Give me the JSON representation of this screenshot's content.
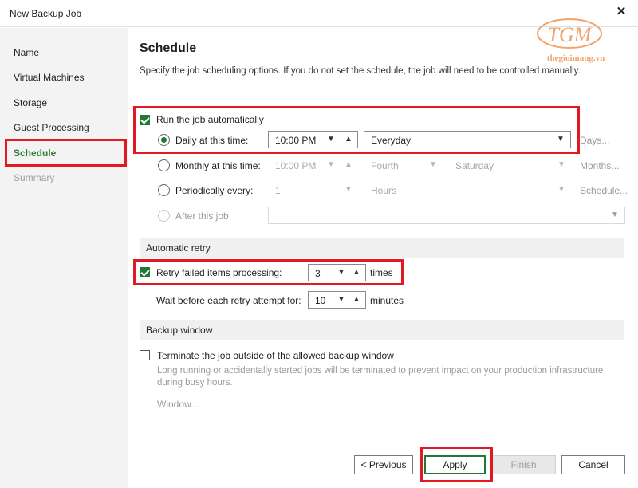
{
  "window": {
    "title": "New Backup Job",
    "close_label": "✕"
  },
  "watermark": {
    "logo_text": "TGM",
    "site": "thegioimang.vn"
  },
  "sidebar": {
    "items": [
      {
        "label": "Name",
        "state": "normal"
      },
      {
        "label": "Virtual Machines",
        "state": "normal"
      },
      {
        "label": "Storage",
        "state": "normal"
      },
      {
        "label": "Guest Processing",
        "state": "normal"
      },
      {
        "label": "Schedule",
        "state": "active"
      },
      {
        "label": "Summary",
        "state": "disabled"
      }
    ]
  },
  "page": {
    "title": "Schedule",
    "description": "Specify the job scheduling options. If you do not set the schedule, the job will need to be controlled manually."
  },
  "schedule": {
    "run_automatically_label": "Run the job automatically",
    "daily": {
      "label": "Daily at this time:",
      "time": "10:00 PM",
      "frequency": "Everyday",
      "suffix": "Days..."
    },
    "monthly": {
      "label": "Monthly at this time:",
      "time": "10:00 PM",
      "week": "Fourth",
      "day": "Saturday",
      "suffix": "Months..."
    },
    "periodically": {
      "label": "Periodically every:",
      "value": "1",
      "unit": "Hours",
      "suffix": "Schedule..."
    },
    "after_job": {
      "label": "After this job:",
      "value": ""
    }
  },
  "retry": {
    "section_label": "Automatic retry",
    "retry_label": "Retry failed items processing:",
    "retry_count": "3",
    "retry_unit": "times",
    "wait_label": "Wait before each retry attempt for:",
    "wait_value": "10",
    "wait_unit": "minutes"
  },
  "backup_window": {
    "section_label": "Backup window",
    "terminate_label": "Terminate the job outside of the allowed backup window",
    "note_line1": "Long running or accidentally started jobs will be terminated to prevent impact on your production infrastructure",
    "note_line2": "during busy hours.",
    "window_link": "Window..."
  },
  "buttons": {
    "previous": "< Previous",
    "apply": "Apply",
    "finish": "Finish",
    "cancel": "Cancel"
  },
  "icons": {
    "chevron_down": "chevron-down-icon",
    "chevron_up": "chevron-up-icon"
  },
  "colors": {
    "accent_green": "#1f7a34",
    "highlight_red": "#e01922"
  }
}
